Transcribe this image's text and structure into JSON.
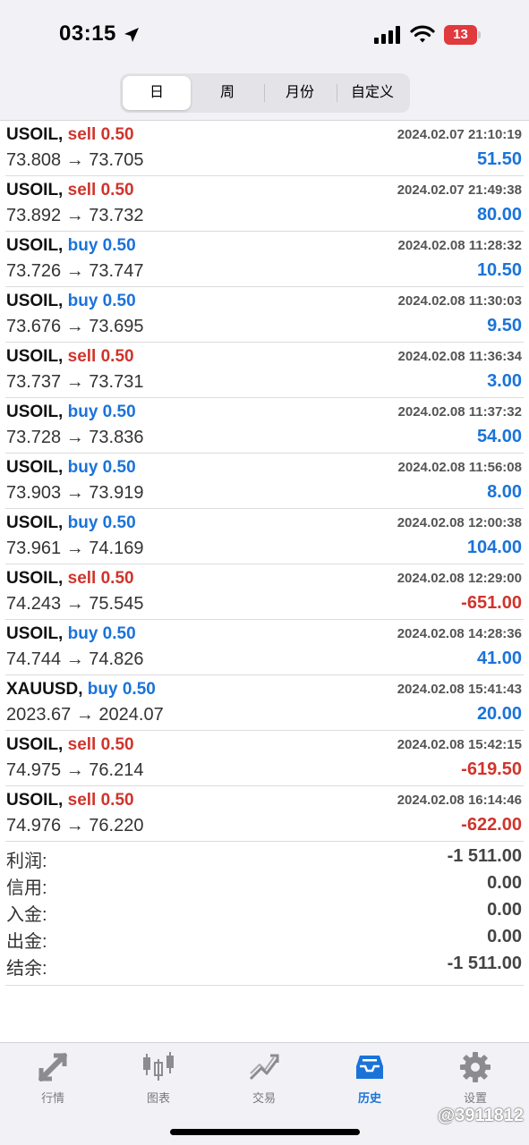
{
  "status_bar": {
    "time": "03:15",
    "battery": "13",
    "icons": [
      "location-arrow-icon",
      "signal-icon",
      "wifi-icon",
      "battery-icon"
    ]
  },
  "segments": [
    {
      "label": "日",
      "active": true
    },
    {
      "label": "周",
      "active": false
    },
    {
      "label": "月份",
      "active": false
    },
    {
      "label": "自定义",
      "active": false
    }
  ],
  "trades": [
    {
      "symbol": "USOIL,",
      "side": "sell 0.50",
      "type": "sell",
      "datetime": "2024.02.07 21:10:19",
      "prices": "73.808 → 73.705",
      "profit": "51.50",
      "sign": "pos"
    },
    {
      "symbol": "USOIL,",
      "side": "sell 0.50",
      "type": "sell",
      "datetime": "2024.02.07 21:49:38",
      "prices": "73.892 → 73.732",
      "profit": "80.00",
      "sign": "pos"
    },
    {
      "symbol": "USOIL,",
      "side": "buy 0.50",
      "type": "buy",
      "datetime": "2024.02.08 11:28:32",
      "prices": "73.726 → 73.747",
      "profit": "10.50",
      "sign": "pos"
    },
    {
      "symbol": "USOIL,",
      "side": "buy 0.50",
      "type": "buy",
      "datetime": "2024.02.08 11:30:03",
      "prices": "73.676 → 73.695",
      "profit": "9.50",
      "sign": "pos"
    },
    {
      "symbol": "USOIL,",
      "side": "sell 0.50",
      "type": "sell",
      "datetime": "2024.02.08 11:36:34",
      "prices": "73.737 → 73.731",
      "profit": "3.00",
      "sign": "pos"
    },
    {
      "symbol": "USOIL,",
      "side": "buy 0.50",
      "type": "buy",
      "datetime": "2024.02.08 11:37:32",
      "prices": "73.728 → 73.836",
      "profit": "54.00",
      "sign": "pos"
    },
    {
      "symbol": "USOIL,",
      "side": "buy 0.50",
      "type": "buy",
      "datetime": "2024.02.08 11:56:08",
      "prices": "73.903 → 73.919",
      "profit": "8.00",
      "sign": "pos"
    },
    {
      "symbol": "USOIL,",
      "side": "buy 0.50",
      "type": "buy",
      "datetime": "2024.02.08 12:00:38",
      "prices": "73.961 → 74.169",
      "profit": "104.00",
      "sign": "pos"
    },
    {
      "symbol": "USOIL,",
      "side": "sell 0.50",
      "type": "sell",
      "datetime": "2024.02.08 12:29:00",
      "prices": "74.243 → 75.545",
      "profit": "-651.00",
      "sign": "neg"
    },
    {
      "symbol": "USOIL,",
      "side": "buy 0.50",
      "type": "buy",
      "datetime": "2024.02.08 14:28:36",
      "prices": "74.744 → 74.826",
      "profit": "41.00",
      "sign": "pos"
    },
    {
      "symbol": "XAUUSD,",
      "side": "buy 0.50",
      "type": "buy",
      "datetime": "2024.02.08 15:41:43",
      "prices": "2023.67 → 2024.07",
      "profit": "20.00",
      "sign": "pos"
    },
    {
      "symbol": "USOIL,",
      "side": "sell 0.50",
      "type": "sell",
      "datetime": "2024.02.08 15:42:15",
      "prices": "74.975 → 76.214",
      "profit": "-619.50",
      "sign": "neg"
    },
    {
      "symbol": "USOIL,",
      "side": "sell 0.50",
      "type": "sell",
      "datetime": "2024.02.08 16:14:46",
      "prices": "74.976 → 76.220",
      "profit": "-622.00",
      "sign": "neg"
    }
  ],
  "summary": [
    {
      "label": "利润:",
      "value": "-1 511.00"
    },
    {
      "label": "信用:",
      "value": "0.00"
    },
    {
      "label": "入金:",
      "value": "0.00"
    },
    {
      "label": "出金:",
      "value": "0.00"
    },
    {
      "label": "结余:",
      "value": "-1 511.00"
    }
  ],
  "tabs": [
    {
      "label": "行情",
      "icon": "quotes-arrows-icon",
      "active": false
    },
    {
      "label": "图表",
      "icon": "chart-candles-icon",
      "active": false
    },
    {
      "label": "交易",
      "icon": "trade-trend-icon",
      "active": false
    },
    {
      "label": "历史",
      "icon": "history-inbox-icon",
      "active": true
    },
    {
      "label": "设置",
      "icon": "settings-gear-icon",
      "active": false
    }
  ],
  "watermark": "@3911812",
  "colors": {
    "buy": "#1a73d9",
    "sell": "#d0342c",
    "active_tab": "#1a73d9",
    "inactive_tab": "#7a7a7e"
  }
}
